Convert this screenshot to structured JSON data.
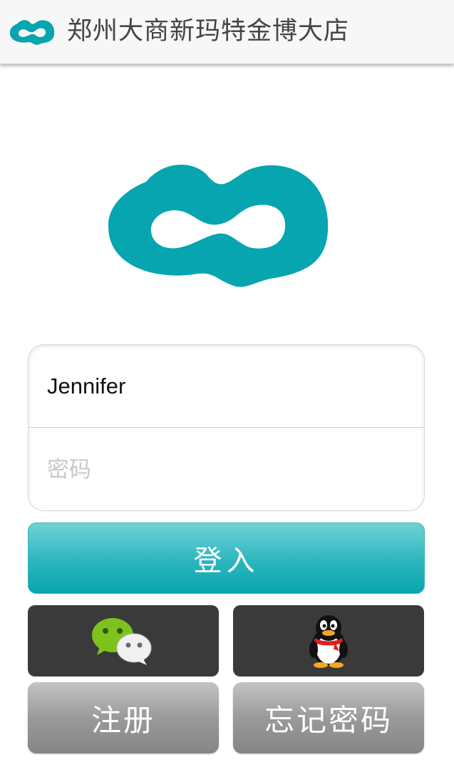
{
  "header": {
    "title": "郑州大商新玛特金博大店",
    "logo_icon": "infinity-logo"
  },
  "login_form": {
    "username_value": "Jennifer",
    "password_placeholder": "密码"
  },
  "buttons": {
    "login_label": "登入",
    "wechat_icon": "wechat-icon",
    "qq_icon": "qq-penguin-icon",
    "register_label": "注册",
    "forgot_password_label": "忘记密码"
  },
  "colors": {
    "brand_teal": "#07a5b0",
    "social_button_bg": "#3a3a3a"
  }
}
